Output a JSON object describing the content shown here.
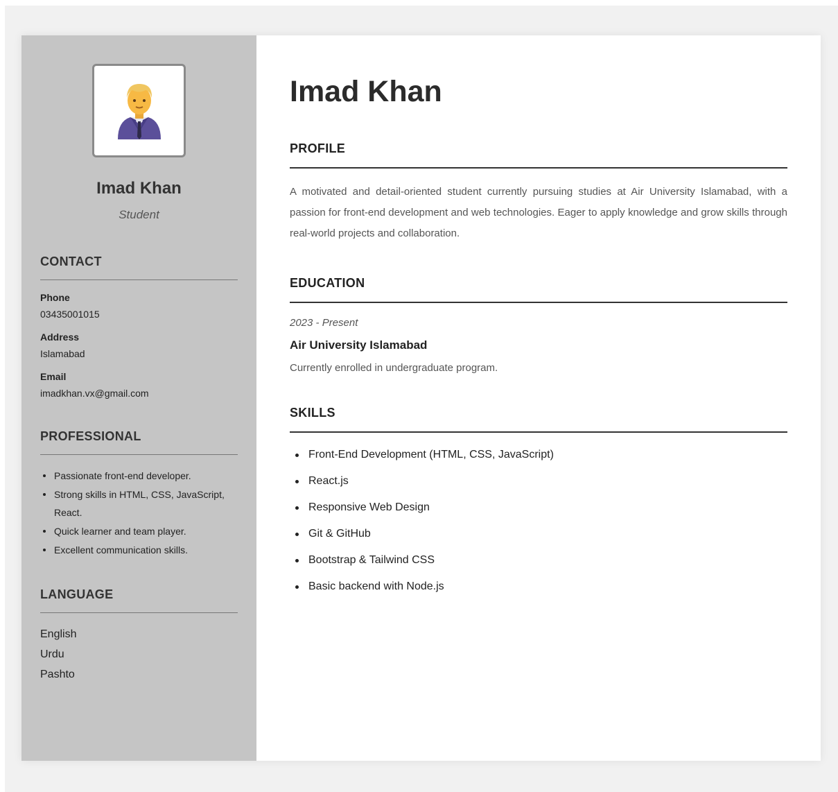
{
  "sidebar": {
    "avatar_icon": "person-in-suit-icon",
    "name": "Imad Khan",
    "role": "Student",
    "contact": {
      "heading": "CONTACT",
      "items": [
        {
          "label": "Phone",
          "value": "03435001015"
        },
        {
          "label": "Address",
          "value": "Islamabad"
        },
        {
          "label": "Email",
          "value": "imadkhan.vx@gmail.com"
        }
      ]
    },
    "professional": {
      "heading": "PROFESSIONAL",
      "items": [
        "Passionate front-end developer.",
        "Strong skills in HTML, CSS, JavaScript, React.",
        "Quick learner and team player.",
        "Excellent communication skills."
      ]
    },
    "language": {
      "heading": "LANGUAGE",
      "items": [
        "English",
        "Urdu",
        "Pashto"
      ]
    }
  },
  "main": {
    "name": "Imad Khan",
    "profile": {
      "heading": "PROFILE",
      "text": "A motivated and detail-oriented student currently pursuing studies at Air University Islamabad, with a passion for front-end development and web technologies. Eager to apply knowledge and grow skills through real-world projects and collaboration."
    },
    "education": {
      "heading": "EDUCATION",
      "date": "2023 - Present",
      "school": "Air University Islamabad",
      "description": "Currently enrolled in undergraduate program."
    },
    "skills": {
      "heading": "SKILLS",
      "items": [
        "Front-End Development (HTML, CSS, JavaScript)",
        "React.js",
        "Responsive Web Design",
        "Git & GitHub",
        "Bootstrap & Tailwind CSS",
        "Basic backend with Node.js"
      ]
    }
  },
  "colors": {
    "sidebar_bg": "#c5c5c5",
    "page_bg": "#f1f1f1",
    "text_dark": "#222222"
  }
}
